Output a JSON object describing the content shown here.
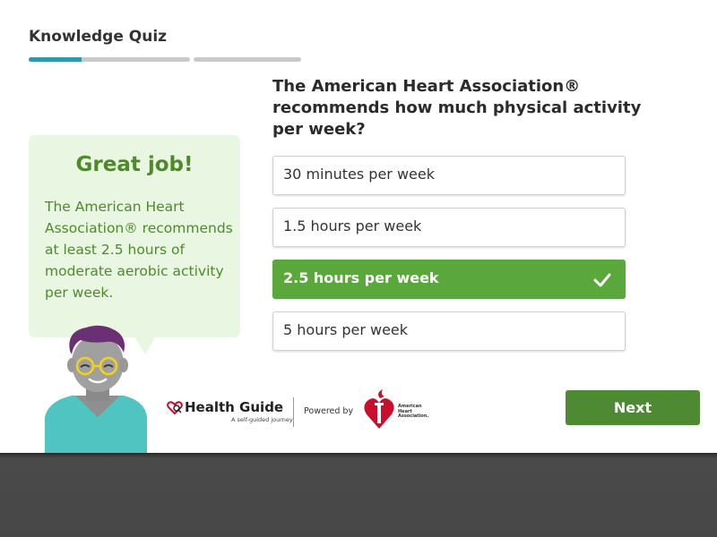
{
  "quiz": {
    "title": "Knowledge Quiz",
    "progress_fraction_segment1": 0.33,
    "question": "The American Heart Association® recommends how much physical activity per week?"
  },
  "options": [
    {
      "label": "30 minutes per week",
      "selected": false
    },
    {
      "label": "1.5 hours per week",
      "selected": false
    },
    {
      "label": "2.5 hours per week",
      "selected": true
    },
    {
      "label": "5 hours per week",
      "selected": false
    }
  ],
  "feedback": {
    "title": "Great job!",
    "text": "The American Heart Association® recommends at least 2.5 hours of moderate aerobic activity per week."
  },
  "branding": {
    "logo_name": "Health Guide",
    "logo_tagline": "A self-guided journey",
    "powered_by": "Powered by",
    "aha_line1": "American",
    "aha_line2": "Heart",
    "aha_line3": "Association."
  },
  "actions": {
    "next_label": "Next"
  },
  "colors": {
    "accent_green": "#5aa73b",
    "button_green": "#4e8a32",
    "progress_teal": "#2e9aa8",
    "feedback_bg": "#e9f6e2",
    "aha_red": "#c8102e"
  }
}
